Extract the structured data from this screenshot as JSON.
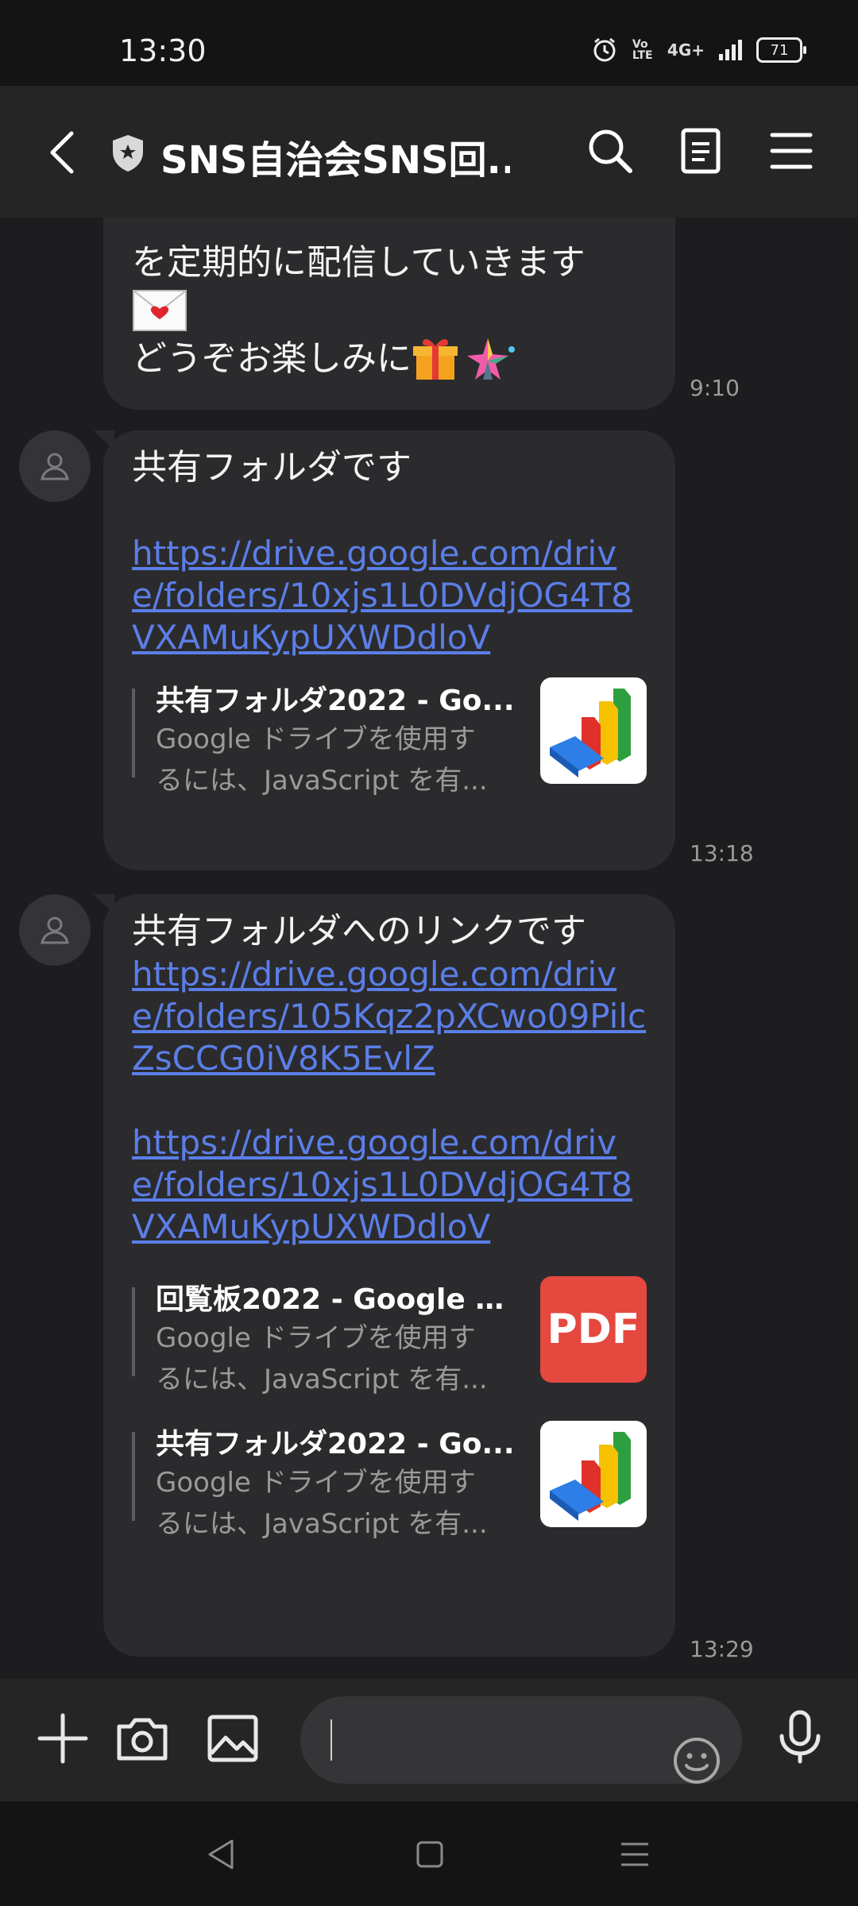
{
  "status": {
    "time": "13:30",
    "network": "4G+",
    "volte": "Vo LTE",
    "battery": "71"
  },
  "header": {
    "title": "SNS自治会SNS回..."
  },
  "messages": [
    {
      "lines": [
        "を定期的に配信していきます",
        "どうぞお楽しみに"
      ],
      "time": "9:10"
    },
    {
      "text": "共有フォルダです",
      "links": [
        "https://drive.google.com/drive/folders/10xjs1L0DVdjOG4T8VXAMuKypUXWDdloV"
      ],
      "previews": [
        {
          "title": "共有フォルダ2022 - Go...",
          "desc1": "Google ドライブを使用す",
          "desc2": "るには、JavaScript を有...",
          "thumb": "google-drive-icon"
        }
      ],
      "time": "13:18"
    },
    {
      "text": "共有フォルダへのリンクです",
      "links": [
        "https://drive.google.com/drive/folders/105Kqz2pXCwo09PilcZsCCG0iV8K5EvlZ",
        "https://drive.google.com/drive/folders/10xjs1L0DVdjOG4T8VXAMuKypUXWDdloV"
      ],
      "previews": [
        {
          "title": "回覧板2022 - Google ド...",
          "desc1": "Google ドライブを使用す",
          "desc2": "るには、JavaScript を有...",
          "thumb": "PDF"
        },
        {
          "title": "共有フォルダ2022 - Go...",
          "desc1": "Google ドライブを使用す",
          "desc2": "るには、JavaScript を有...",
          "thumb": "google-drive-icon"
        }
      ],
      "time": "13:29"
    }
  ],
  "input": {
    "value": ""
  }
}
